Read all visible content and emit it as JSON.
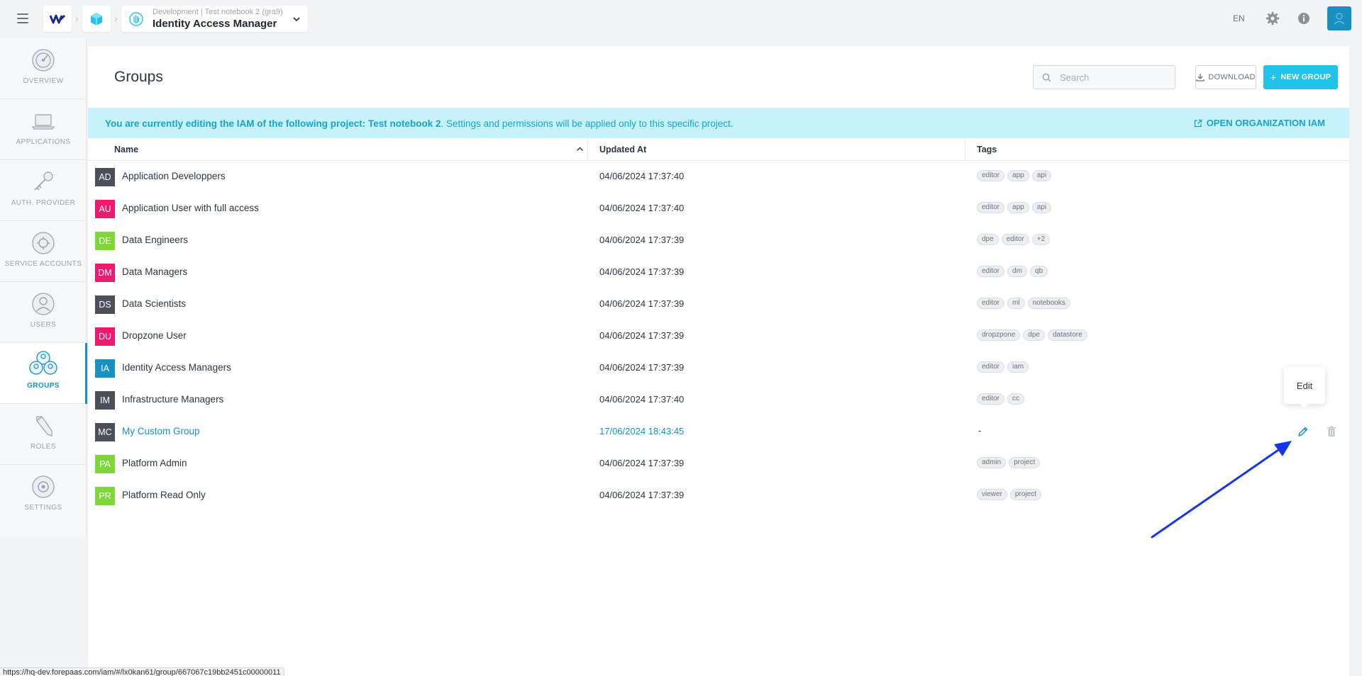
{
  "topbar": {
    "breadcrumb_env": "Development",
    "breadcrumb_project": "Test notebook 2 (gra9)",
    "app_title": "Identity Access Manager",
    "language": "EN"
  },
  "nav": {
    "items": [
      {
        "label": "OVERVIEW",
        "icon": "overview-icon"
      },
      {
        "label": "APPLICATIONS",
        "icon": "laptop-icon"
      },
      {
        "label": "AUTH. PROVIDER",
        "icon": "key-icon"
      },
      {
        "label": "SERVICE ACCOUNTS",
        "icon": "service-accounts-icon"
      },
      {
        "label": "USERS",
        "icon": "user-icon"
      },
      {
        "label": "GROUPS",
        "icon": "groups-icon",
        "active": true
      },
      {
        "label": "ROLES",
        "icon": "pencil-icon"
      },
      {
        "label": "SETTINGS",
        "icon": "gear-icon"
      }
    ]
  },
  "page": {
    "title": "Groups",
    "search_placeholder": "Search",
    "download_label": "DOWNLOAD",
    "new_group_label": "NEW GROUP"
  },
  "banner": {
    "prefix": "You are currently editing the IAM of the following project: Test notebook 2",
    "suffix": ". Settings and permissions will be applied only to this specific project.",
    "link_label": "OPEN ORGANIZATION IAM"
  },
  "table": {
    "columns": {
      "name": "Name",
      "updated": "Updated At",
      "tags": "Tags"
    },
    "rows": [
      {
        "initials": "AD",
        "color": "#4a4f5a",
        "name": "Application Developpers",
        "updated": "04/06/2024 17:37:40",
        "tags": [
          "editor",
          "app",
          "api"
        ]
      },
      {
        "initials": "AU",
        "color": "#f0196e",
        "name": "Application User with full access",
        "updated": "04/06/2024 17:37:40",
        "tags": [
          "editor",
          "app",
          "api"
        ]
      },
      {
        "initials": "DE",
        "color": "#7fd63a",
        "name": "Data Engineers",
        "updated": "04/06/2024 17:37:39",
        "tags": [
          "dpe",
          "editor",
          "+2"
        ]
      },
      {
        "initials": "DM",
        "color": "#f0196e",
        "name": "Data Managers",
        "updated": "04/06/2024 17:37:39",
        "tags": [
          "editor",
          "dm",
          "qb"
        ]
      },
      {
        "initials": "DS",
        "color": "#4a4f5a",
        "name": "Data Scientists",
        "updated": "04/06/2024 17:37:39",
        "tags": [
          "editor",
          "ml",
          "notebooks"
        ]
      },
      {
        "initials": "DU",
        "color": "#f0196e",
        "name": "Dropzone User",
        "updated": "04/06/2024 17:37:39",
        "tags": [
          "dropzpone",
          "dpe",
          "datastore"
        ]
      },
      {
        "initials": "IA",
        "color": "#1a8fc2",
        "name": "Identity Access Managers",
        "updated": "04/06/2024 17:37:39",
        "tags": [
          "editor",
          "iam"
        ]
      },
      {
        "initials": "IM",
        "color": "#4a4f5a",
        "name": "Infrastructure Managers",
        "updated": "04/06/2024 17:37:40",
        "tags": [
          "editor",
          "cc"
        ]
      },
      {
        "initials": "MC",
        "color": "#4a4f5a",
        "name": "My Custom Group",
        "updated": "17/06/2024 18:43:45",
        "tags": [],
        "empty_tag": "-",
        "highlighted": true
      },
      {
        "initials": "PA",
        "color": "#7fd63a",
        "name": "Platform Admin",
        "updated": "04/06/2024 17:37:39",
        "tags": [
          "admin",
          "project"
        ]
      },
      {
        "initials": "PR",
        "color": "#7fd63a",
        "name": "Platform Read Only",
        "updated": "04/06/2024 17:37:39",
        "tags": [
          "viewer",
          "project"
        ]
      }
    ]
  },
  "tooltip": {
    "label": "Edit"
  },
  "status_bar": {
    "url": "https://hq-dev.forepaas.com/iam/#/lx0kan61/group/667067c19bb2451c00000011"
  },
  "colors": {
    "accent": "#1493c4",
    "primary_button": "#22c3e8",
    "banner_bg": "#c5f2fb",
    "annotation_arrow": "#1436e8"
  }
}
